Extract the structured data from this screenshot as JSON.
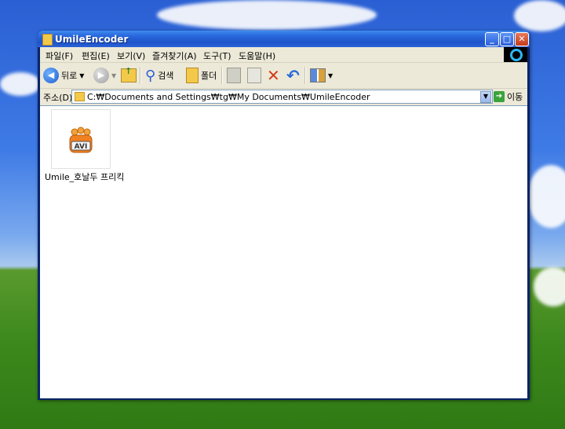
{
  "window": {
    "title": "UmileEncoder",
    "buttons": {
      "minimize": "_",
      "maximize": "□",
      "close": "✕"
    }
  },
  "menu": [
    "파일(F)",
    "편집(E)",
    "보기(V)",
    "즐겨찾기(A)",
    "도구(T)",
    "도움말(H)"
  ],
  "toolbar": {
    "back_label": "뒤로",
    "search_label": "검색",
    "folders_label": "폴더"
  },
  "address": {
    "label": "주소(D)",
    "path": "C:₩Documents and Settings₩tg₩My Documents₩UmileEncoder",
    "go_label": "이동"
  },
  "files": [
    {
      "name": "Umile_호날두 프리킥",
      "icon": "avi-file-icon",
      "type_label": "AVI"
    }
  ],
  "colors": {
    "title_bar": "#2a69dd",
    "frame": "#ece9d8",
    "content_bg": "#ffffff"
  }
}
